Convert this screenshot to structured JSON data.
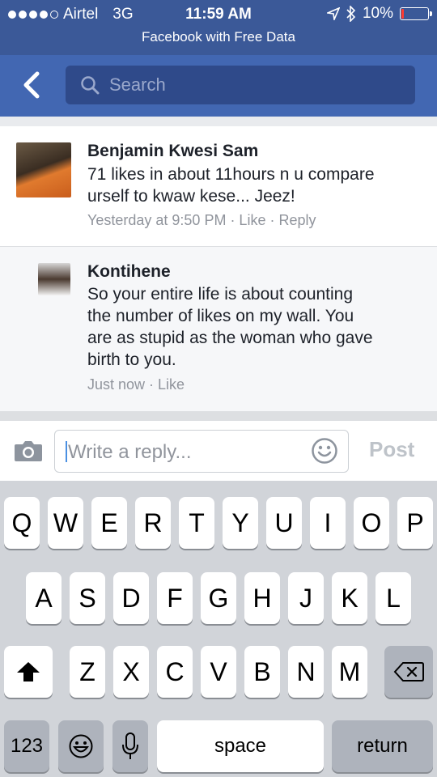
{
  "status_bar": {
    "carrier": "Airtel",
    "network": "3G",
    "time": "11:59 AM",
    "battery": "10%",
    "battery_level": 0.1,
    "subtitle": "Facebook with Free Data"
  },
  "nav": {
    "search_placeholder": "Search"
  },
  "comments": [
    {
      "author": "Benjamin Kwesi Sam",
      "text_lines": [
        "71 likes in about 11hours n u compare",
        "urself to kwaw kese... Jeez!"
      ],
      "meta": "Yesterday at 9:50 PM · Like · Reply"
    },
    {
      "author": "Kontihene",
      "text_lines": [
        "So your entire life is about counting",
        "the number of likes on my wall. You",
        "are as stupid as the woman who gave",
        "birth to you."
      ],
      "meta": "Just now · Like"
    }
  ],
  "composer": {
    "placeholder": "Write a reply...",
    "post_label": "Post"
  },
  "keyboard": {
    "row1": [
      "Q",
      "W",
      "E",
      "R",
      "T",
      "Y",
      "U",
      "I",
      "O",
      "P"
    ],
    "row2": [
      "A",
      "S",
      "D",
      "F",
      "G",
      "H",
      "J",
      "K",
      "L"
    ],
    "row3": [
      "Z",
      "X",
      "C",
      "V",
      "B",
      "N",
      "M"
    ],
    "numbers_label": "123",
    "space_label": "space",
    "return_label": "return"
  },
  "colors": {
    "facebook_blue": "#3b5998",
    "nav_blue": "#4267b2",
    "battery_low": "#ff3b30"
  }
}
